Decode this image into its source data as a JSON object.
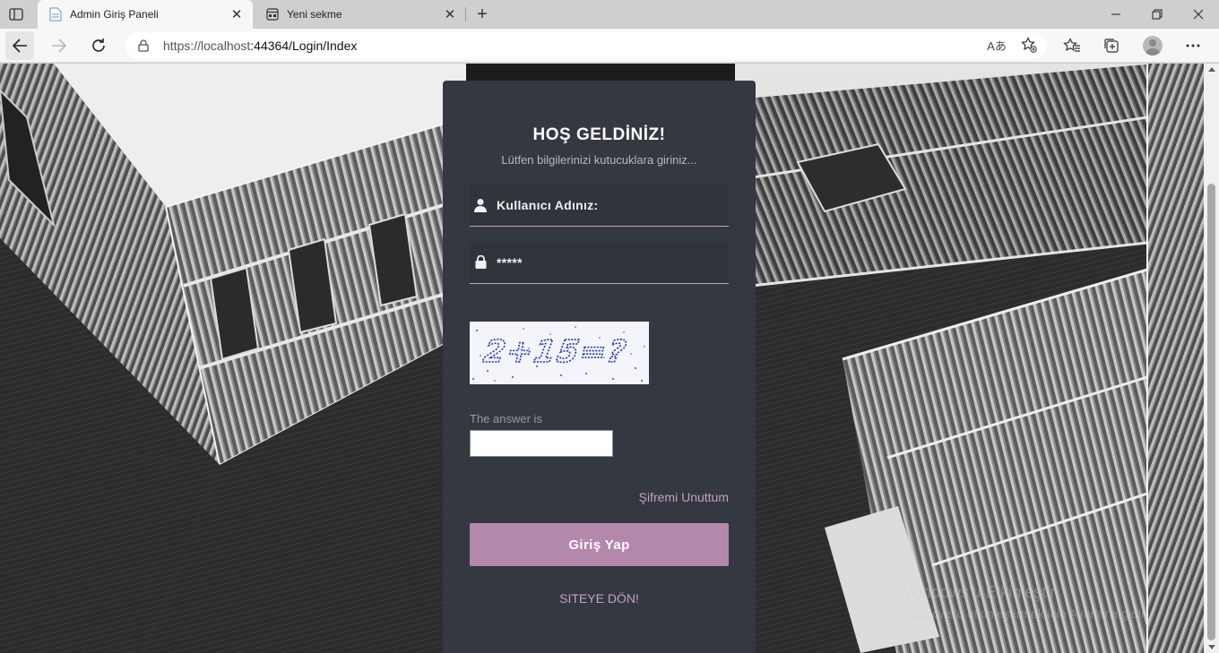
{
  "browser": {
    "tabs": [
      {
        "title": "Admin Giriş Paneli",
        "active": true
      },
      {
        "title": "Yeni sekme",
        "active": false
      }
    ],
    "address": {
      "prefix": "https://localhost",
      "rest": ":44364/Login/Index"
    },
    "read_aloud_icon": "Aあ"
  },
  "login": {
    "title": "HOŞ GELDİNİZ!",
    "subtitle": "Lütfen bilgilerinizi kutucuklara giriniz...",
    "username_placeholder": "Kullanıcı Adınız:",
    "password_value": "*****",
    "captcha_text": "2+15=?",
    "captcha_label": "The answer is",
    "captcha_answer": "",
    "forgot_label": "Şifremi Unuttum",
    "submit_label": "Giriş Yap",
    "back_label": "SITEYE DÖN!"
  },
  "watermark": {
    "line1": "Windows'u Etkinleştir",
    "line2": "Windows'u etkinleştirmek için Ayarlar'a gidin."
  },
  "colors": {
    "card_bg": "#343840",
    "accent": "#b487ac",
    "link": "#c89fc4",
    "captcha_ink": "#1a2fb8"
  }
}
